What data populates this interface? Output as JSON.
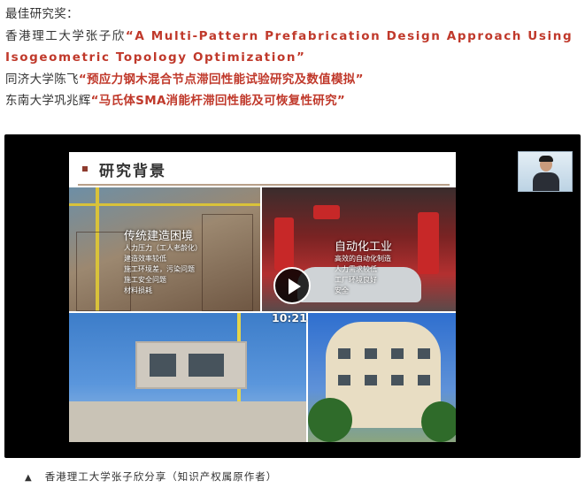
{
  "article": {
    "award_heading": "最佳研究奖：",
    "entries": [
      {
        "author": "香港理工大学张子欣",
        "title": "“A Multi-Pattern Prefabrication Design Approach Using Isogeometric Topology Optimization”"
      },
      {
        "author": "同济大学陈飞",
        "title": "“预应力钢木混合节点滞回性能试验研究及数值模拟”"
      },
      {
        "author": "东南大学巩兆辉",
        "title": "“马氏体SMA消能杆滞回性能及可恢复性研究”"
      }
    ]
  },
  "video": {
    "duration": "10:21",
    "slide": {
      "title": "研究背景",
      "panel_left": {
        "title": "传统建造困境",
        "items": [
          "人力压力（工人老龄化）",
          "建造效率较低",
          "施工环境差，污染问题",
          "施工安全问题",
          "材料损耗"
        ]
      },
      "panel_right": {
        "title": "自动化工业",
        "items": [
          "高效的自动化制造",
          "人力需求较低",
          "工厂环境良好",
          "安全"
        ]
      }
    }
  },
  "caption": {
    "marker": "▲",
    "text": "香港理工大学张子欣分享（知识产权属原作者）"
  },
  "colors": {
    "highlight": "#c0392b",
    "player_bg": "#000000"
  },
  "icons": {
    "play": "play-icon",
    "caption_marker": "triangle-up-icon"
  }
}
